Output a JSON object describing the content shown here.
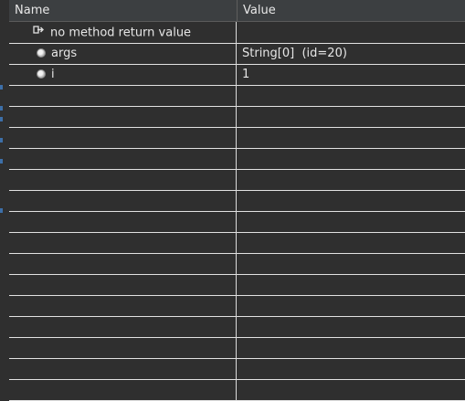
{
  "columns": {
    "name": "Name",
    "value": "Value"
  },
  "rows": [
    {
      "icon": "return-value-icon",
      "name": "no method return value",
      "value": ""
    },
    {
      "icon": "local-variable-icon",
      "name": "args",
      "value": "String[0]  (id=20)"
    },
    {
      "icon": "local-variable-icon",
      "name": "i",
      "value": "1"
    }
  ],
  "empty_row_count": 15,
  "colors": {
    "background": "#2f2f2f",
    "header": "#3c3f41",
    "grid": "#e2e2e2",
    "text": "#e6e6e6"
  }
}
